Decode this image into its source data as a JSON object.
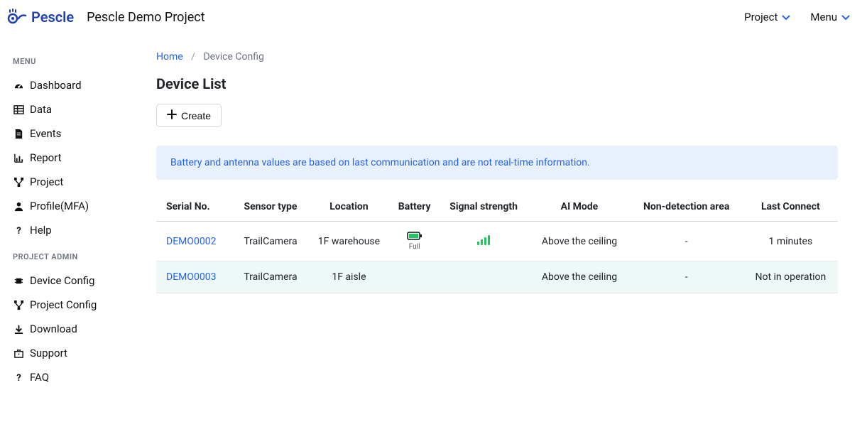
{
  "header": {
    "brand": "Pescle",
    "project_name": "Pescle Demo Project",
    "project_dropdown": "Project",
    "menu_dropdown": "Menu"
  },
  "sidebar": {
    "section1_label": "MENU",
    "items1": [
      {
        "label": "Dashboard",
        "icon": "tachometer-icon"
      },
      {
        "label": "Data",
        "icon": "table-icon"
      },
      {
        "label": "Events",
        "icon": "file-icon"
      },
      {
        "label": "Report",
        "icon": "chart-icon"
      },
      {
        "label": "Project",
        "icon": "flow-icon"
      },
      {
        "label": "Profile(MFA)",
        "icon": "user-icon"
      },
      {
        "label": "Help",
        "icon": "question-icon"
      }
    ],
    "section2_label": "PROJECT ADMIN",
    "items2": [
      {
        "label": "Device Config",
        "icon": "microchip-icon"
      },
      {
        "label": "Project Config",
        "icon": "flow-icon"
      },
      {
        "label": "Download",
        "icon": "download-icon"
      },
      {
        "label": "Support",
        "icon": "briefcase-icon"
      },
      {
        "label": "FAQ",
        "icon": "question-icon"
      }
    ]
  },
  "breadcrumb": {
    "home": "Home",
    "current": "Device Config"
  },
  "page_title": "Device List",
  "buttons": {
    "create": "Create"
  },
  "info_banner": "Battery and antenna values are based on last communication and are not real-time information.",
  "table": {
    "headers": {
      "serial": "Serial No.",
      "sensor_type": "Sensor type",
      "location": "Location",
      "battery": "Battery",
      "signal": "Signal strength",
      "ai_mode": "AI Mode",
      "non_detect": "Non-detection area",
      "last_connect": "Last Connect"
    },
    "rows": [
      {
        "serial": "DEMO0002",
        "sensor_type": "TrailCamera",
        "location": "1F warehouse",
        "battery_label": "Full",
        "battery_has_icon": true,
        "signal_has_icon": true,
        "ai_mode": "Above the ceiling",
        "non_detect": "-",
        "last_connect": "1 minutes",
        "alt": false
      },
      {
        "serial": "DEMO0003",
        "sensor_type": "TrailCamera",
        "location": "1F aisle",
        "battery_label": "",
        "battery_has_icon": false,
        "signal_has_icon": false,
        "ai_mode": "Above the ceiling",
        "non_detect": "-",
        "last_connect": "Not in operation",
        "alt": true
      }
    ]
  }
}
